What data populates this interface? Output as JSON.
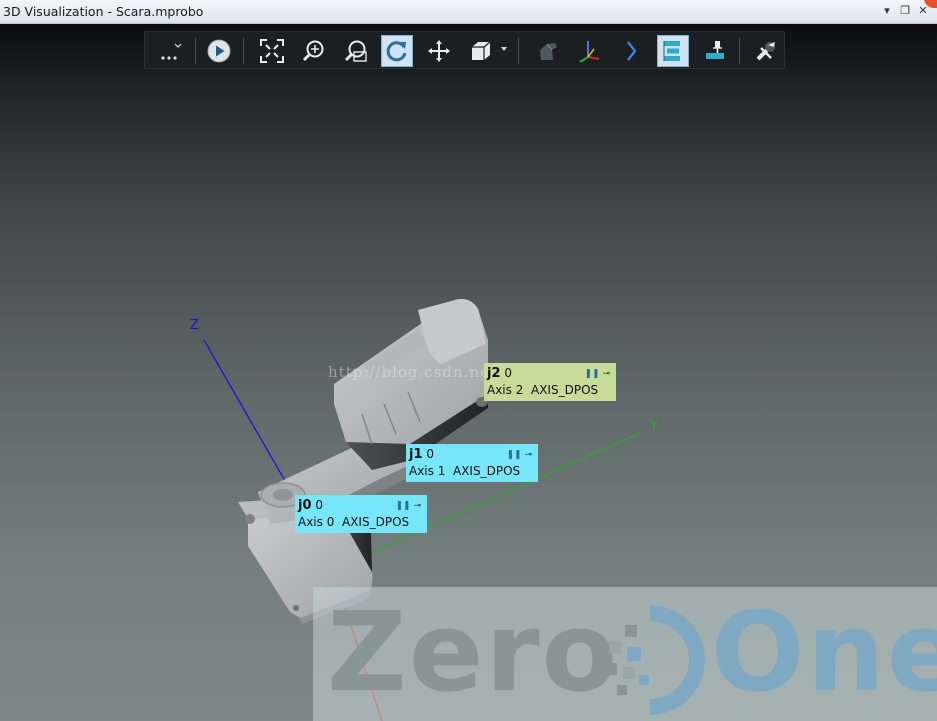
{
  "window": {
    "title": "3D Visualization - Scara.mprobo",
    "buttons": {
      "menu": "▾",
      "restore": "❐",
      "close": "✕"
    }
  },
  "toolbar": {
    "buttons": [
      {
        "name": "more-options",
        "icon": "ellipsis-icon",
        "active": false
      },
      {
        "name": "play",
        "icon": "play-icon",
        "active": false
      },
      {
        "name": "fit-view",
        "icon": "fit-view-icon",
        "active": false
      },
      {
        "name": "zoom",
        "icon": "zoom-in-icon",
        "active": false
      },
      {
        "name": "zoom-window",
        "icon": "zoom-window-icon",
        "active": false
      },
      {
        "name": "rotate",
        "icon": "rotate-icon",
        "active": true
      },
      {
        "name": "pan",
        "icon": "pan-icon",
        "active": false
      },
      {
        "name": "view-cube",
        "icon": "cube-icon",
        "active": false
      },
      {
        "name": "model",
        "icon": "model-icon",
        "active": false
      },
      {
        "name": "axes",
        "icon": "axes-icon",
        "active": false
      },
      {
        "name": "next",
        "icon": "chevron-right-icon",
        "active": false
      },
      {
        "name": "joint-labels",
        "icon": "labels-icon",
        "active": true
      },
      {
        "name": "pin",
        "icon": "pin-icon",
        "active": false
      },
      {
        "name": "settings",
        "icon": "tools-icon",
        "active": false
      }
    ]
  },
  "axes": {
    "z": "Z",
    "y": "Y"
  },
  "joints": [
    {
      "name": "j2",
      "value": "0",
      "axis": "Axis 2",
      "signal": "AXIS_DPOS",
      "color": "#c8dc9a"
    },
    {
      "name": "j1",
      "value": "0",
      "axis": "Axis 1",
      "signal": "AXIS_DPOS",
      "color": "#78e6fa"
    },
    {
      "name": "j0",
      "value": "0",
      "axis": "Axis 0",
      "signal": "AXIS_DPOS",
      "color": "#78e6fa"
    }
  ],
  "watermark": {
    "url": "http://blog.csdn.net/guimiaoyuan",
    "brand_left": "Zero",
    "brand_right": "One"
  },
  "colors": {
    "z_axis": "#1010e8",
    "y_axis": "#2ea82e",
    "x_axis": "#e01818",
    "active_button": "#cfe4f0",
    "brand_blue": "#7fa9c2",
    "brand_grey": "#8a9596"
  }
}
